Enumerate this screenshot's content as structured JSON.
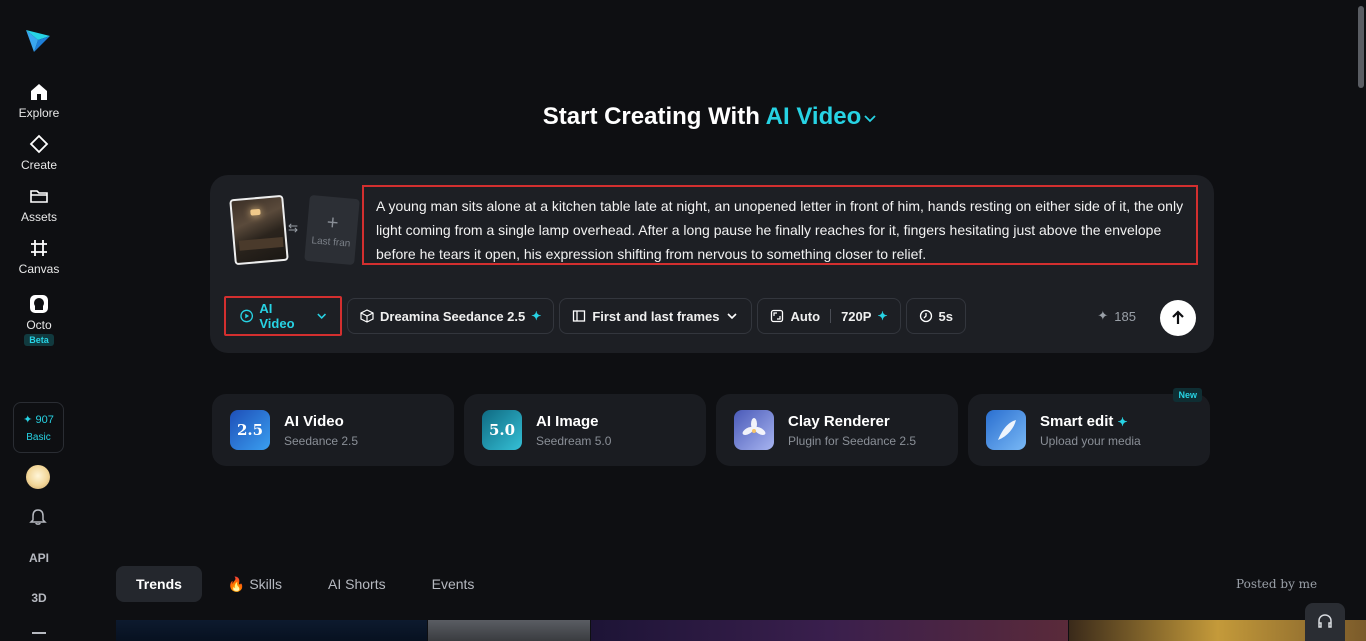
{
  "sidebar": {
    "nav": [
      {
        "label": "Explore",
        "icon": "home-icon"
      },
      {
        "label": "Create",
        "icon": "diamond-icon"
      },
      {
        "label": "Assets",
        "icon": "folder-icon"
      },
      {
        "label": "Canvas",
        "icon": "canvas-icon"
      },
      {
        "label": "Octo",
        "icon": "octo-icon"
      }
    ],
    "octo_badge": "Beta",
    "credits": "907",
    "plan": "Basic",
    "api_label": "API",
    "three_d_label": "3D"
  },
  "hero": {
    "title_prefix": "Start Creating With",
    "title_accent": "AI Video"
  },
  "prompt": {
    "text": "A young man sits alone at a kitchen table late at night, an unopened letter in front of him, hands resting on either side of it, the only light coming from a single lamp overhead. After a long pause he finally reaches for it, fingers hesitating just above the envelope before he tears it open, his expression shifting from nervous to something closer to relief.",
    "last_frame_label": "Last fran"
  },
  "toolbar": {
    "mode": "AI Video",
    "model": "Dreamina Seedance 2.5",
    "frames": "First and last frames",
    "ratio": "Auto",
    "resolution": "720P",
    "duration": "5s",
    "cost": "185"
  },
  "cards": [
    {
      "title": "AI Video",
      "subtitle": "Seedance 2.5",
      "icon_text": "2.5",
      "color": "#2b6fd6"
    },
    {
      "title": "AI Image",
      "subtitle": "Seedream 5.0",
      "icon_text": "5.0",
      "color": "#1d8fa8"
    },
    {
      "title": "Clay Renderer",
      "subtitle": "Plugin for Seedance 2.5",
      "icon_text": "",
      "color": "#6a78c8"
    },
    {
      "title": "Smart edit",
      "subtitle": "Upload your media",
      "icon_text": "",
      "color": "#3a7bd8",
      "badge": "New"
    }
  ],
  "tabs": [
    {
      "label": "Trends",
      "active": true
    },
    {
      "label": "Skills",
      "active": false
    },
    {
      "label": "AI Shorts",
      "active": false
    },
    {
      "label": "Events",
      "active": false
    }
  ],
  "posted_by": "Posted by me",
  "colors": {
    "accent": "#27d3e4",
    "highlight": "#d32f2f"
  }
}
